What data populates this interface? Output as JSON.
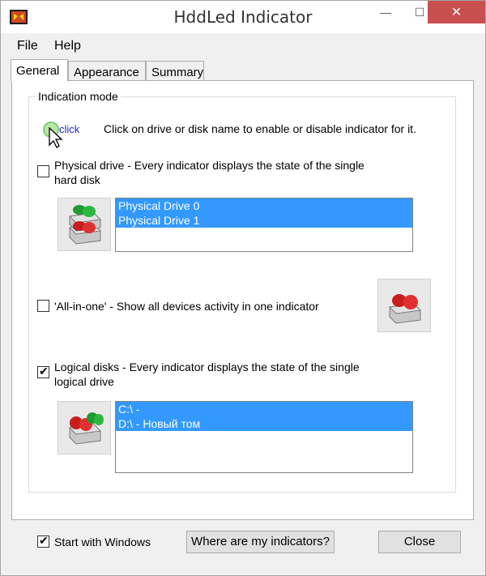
{
  "window": {
    "title": "HddLed Indicator",
    "min_glyph": "—",
    "max_glyph": "☐",
    "close_glyph": "✕"
  },
  "menu": {
    "file": "File",
    "help": "Help"
  },
  "tabs": [
    {
      "label": "General",
      "active": true
    },
    {
      "label": "Appearance",
      "active": false
    },
    {
      "label": "Summary",
      "active": false
    }
  ],
  "group": {
    "title": "Indication mode"
  },
  "hint": {
    "click_label": "click",
    "text": "Click on drive or disk name to enable or disable indicator for it."
  },
  "physical": {
    "checked": false,
    "label_line1": "Physical drive -  Every indicator displays the state of the single",
    "label_line2": "hard disk",
    "items": [
      "Physical Drive 0",
      "Physical Drive 1"
    ]
  },
  "allinone": {
    "checked": false,
    "label": "'All-in-one' - Show all devices activity in one indicator"
  },
  "logical": {
    "checked": true,
    "label_line1": "Logical disks - Every indicator displays the state of the single",
    "label_line2": "logical drive",
    "items": [
      "C:\\ -",
      "D:\\ - Новый том"
    ]
  },
  "bottom": {
    "start_with_windows": {
      "checked": true,
      "label": "Start with Windows"
    },
    "where_button": "Where are my indicators?",
    "close_button": "Close",
    "check_glyph": "✔"
  },
  "colors": {
    "selection": "#3399ff",
    "close_bg": "#c7504f",
    "led_red": "#c81e1e",
    "led_green": "#1f9a2f"
  }
}
